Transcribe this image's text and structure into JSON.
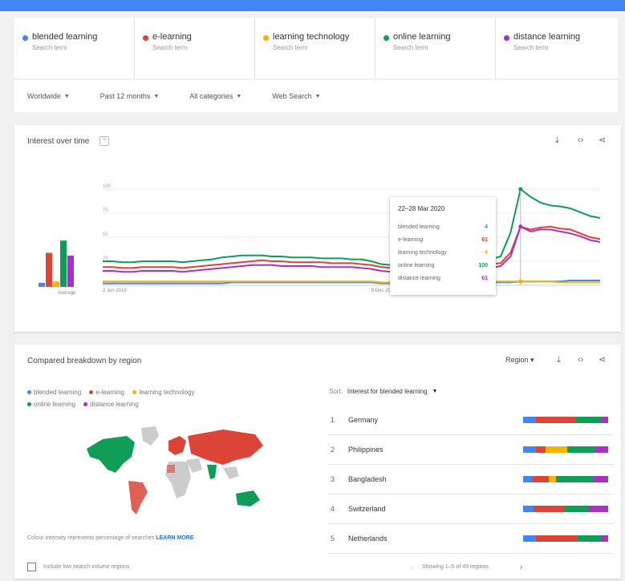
{
  "colors": {
    "blended": "#4285f4",
    "elearning": "#db4437",
    "learning_tech": "#f4b400",
    "online": "#0f9d58",
    "distance": "#ab30c4",
    "accent": "#4285f4"
  },
  "terms": [
    {
      "name": "blended learning",
      "sub": "Search term"
    },
    {
      "name": "e-learning",
      "sub": "Search term"
    },
    {
      "name": "learning technology",
      "sub": "Search term"
    },
    {
      "name": "online learning",
      "sub": "Search term"
    },
    {
      "name": "distance learning",
      "sub": "Search term"
    }
  ],
  "filters": {
    "region": "Worldwide",
    "time": "Past 12 months",
    "category": "All categories",
    "search_type": "Web Search"
  },
  "interest_card": {
    "title": "Interest over time",
    "average_label": "Average",
    "icons": [
      "download-icon",
      "embed-icon",
      "share-icon"
    ]
  },
  "tooltip": {
    "date": "22–28 Mar 2020",
    "rows": [
      {
        "label": "blended learning",
        "value": "4"
      },
      {
        "label": "e-learning",
        "value": "61"
      },
      {
        "label": "learning technology",
        "value": "4"
      },
      {
        "label": "online learning",
        "value": "100"
      },
      {
        "label": "distance learning",
        "value": "61"
      }
    ]
  },
  "chart_data": {
    "type": "line",
    "x": [
      "2 Jun 2019",
      "9 Jun 2019",
      "16 Jun 2019",
      "23 Jun 2019",
      "30 Jun 2019",
      "7 Jul 2019",
      "14 Jul 2019",
      "21 Jul 2019",
      "28 Jul 2019",
      "4 Aug 2019",
      "11 Aug 2019",
      "18 Aug 2019",
      "25 Aug 2019",
      "1 Sep 2019",
      "8 Sep 2019",
      "15 Sep 2019",
      "22 Sep 2019",
      "29 Sep 2019",
      "6 Oct 2019",
      "13 Oct 2019",
      "20 Oct 2019",
      "27 Oct 2019",
      "3 Nov 2019",
      "10 Nov 2019",
      "17 Nov 2019",
      "24 Nov 2019",
      "1 Dec 2019",
      "8 Dec 2019",
      "15 Dec 2019",
      "22 Dec 2019",
      "29 Dec 2019",
      "5 Jan 2020",
      "12 Jan 2020",
      "19 Jan 2020",
      "26 Jan 2020",
      "2 Feb 2020",
      "9 Feb 2020",
      "16 Feb 2020",
      "23 Feb 2020",
      "1 Mar 2020",
      "8 Mar 2020",
      "15 Mar 2020",
      "22 Mar 2020",
      "29 Mar 2020",
      "5 Apr 2020",
      "12 Apr 2020",
      "19 Apr 2020",
      "26 Apr 2020",
      "3 May 2020",
      "10 May 2020",
      "17 May 2020"
    ],
    "x_tick_labels": [
      "2 Jun 2019",
      "8 Dec 2019"
    ],
    "ylim": [
      0,
      100
    ],
    "y_ticks": [
      100,
      75,
      50,
      25
    ],
    "series": [
      {
        "name": "blended learning",
        "values": [
          2,
          2,
          2,
          2,
          2,
          2,
          2,
          2,
          2,
          2,
          2,
          2,
          2,
          3,
          3,
          3,
          3,
          3,
          3,
          3,
          3,
          3,
          3,
          3,
          3,
          3,
          3,
          3,
          2,
          2,
          2,
          3,
          3,
          3,
          3,
          3,
          3,
          3,
          3,
          3,
          3,
          3,
          4,
          4,
          4,
          4,
          4,
          5,
          5,
          5,
          5
        ],
        "average": 3
      },
      {
        "name": "e-learning",
        "values": [
          19,
          19,
          18,
          18,
          19,
          19,
          19,
          19,
          18,
          19,
          20,
          21,
          22,
          23,
          24,
          25,
          26,
          25,
          25,
          24,
          24,
          24,
          24,
          23,
          23,
          23,
          22,
          21,
          19,
          18,
          19,
          21,
          22,
          22,
          22,
          22,
          21,
          21,
          21,
          22,
          23,
          34,
          61,
          58,
          60,
          61,
          59,
          58,
          54,
          50,
          48
        ],
        "average": 25
      },
      {
        "name": "learning technology",
        "values": [
          4,
          4,
          4,
          4,
          4,
          4,
          4,
          4,
          4,
          4,
          4,
          4,
          4,
          4,
          4,
          4,
          4,
          4,
          4,
          4,
          4,
          4,
          4,
          4,
          4,
          4,
          4,
          4,
          3,
          3,
          3,
          4,
          4,
          4,
          4,
          4,
          4,
          4,
          4,
          4,
          4,
          4,
          4,
          4,
          4,
          4,
          3,
          3,
          3,
          3,
          3
        ],
        "average": 4
      },
      {
        "name": "online learning",
        "values": [
          25,
          25,
          24,
          24,
          25,
          25,
          25,
          25,
          24,
          25,
          26,
          27,
          29,
          30,
          31,
          31,
          31,
          30,
          30,
          29,
          29,
          29,
          28,
          28,
          28,
          27,
          27,
          25,
          22,
          21,
          22,
          25,
          26,
          27,
          27,
          27,
          26,
          26,
          26,
          27,
          30,
          55,
          100,
          92,
          86,
          83,
          82,
          80,
          76,
          72,
          70
        ],
        "average": 34
      },
      {
        "name": "distance learning",
        "values": [
          15,
          15,
          14,
          14,
          15,
          15,
          15,
          15,
          14,
          15,
          16,
          17,
          18,
          19,
          20,
          21,
          21,
          21,
          20,
          20,
          20,
          20,
          19,
          19,
          19,
          19,
          18,
          17,
          15,
          14,
          15,
          17,
          18,
          18,
          18,
          18,
          18,
          17,
          17,
          18,
          20,
          30,
          61,
          56,
          58,
          58,
          56,
          54,
          51,
          47,
          45
        ],
        "average": 23
      }
    ]
  },
  "region_card": {
    "title": "Compared breakdown by region",
    "region_select": "Region",
    "legend": [
      "blended learning",
      "e-learning",
      "learning technology",
      "online learning",
      "distance learning"
    ],
    "note_text": "Colour intensity represents percentage of searches",
    "note_link": "LEARN MORE",
    "sort_label": "Sort:",
    "sort_value": "Interest for blended learning",
    "rows": [
      {
        "rank": "1",
        "name": "Germany",
        "shares": [
          0.14,
          0.42,
          0.0,
          0.26,
          0.08
        ]
      },
      {
        "rank": "2",
        "name": "Philippines",
        "shares": [
          0.14,
          0.1,
          0.24,
          0.3,
          0.14
        ]
      },
      {
        "rank": "3",
        "name": "Bangladesh",
        "shares": [
          0.1,
          0.18,
          0.08,
          0.42,
          0.16
        ]
      },
      {
        "rank": "4",
        "name": "Switzerland",
        "shares": [
          0.12,
          0.34,
          0.0,
          0.28,
          0.22
        ]
      },
      {
        "rank": "5",
        "name": "Netherlands",
        "shares": [
          0.14,
          0.46,
          0.0,
          0.26,
          0.08
        ]
      }
    ],
    "checkbox_label": "Include low search volume regions",
    "pager_text": "Showing 1–5 of 49 regions"
  }
}
